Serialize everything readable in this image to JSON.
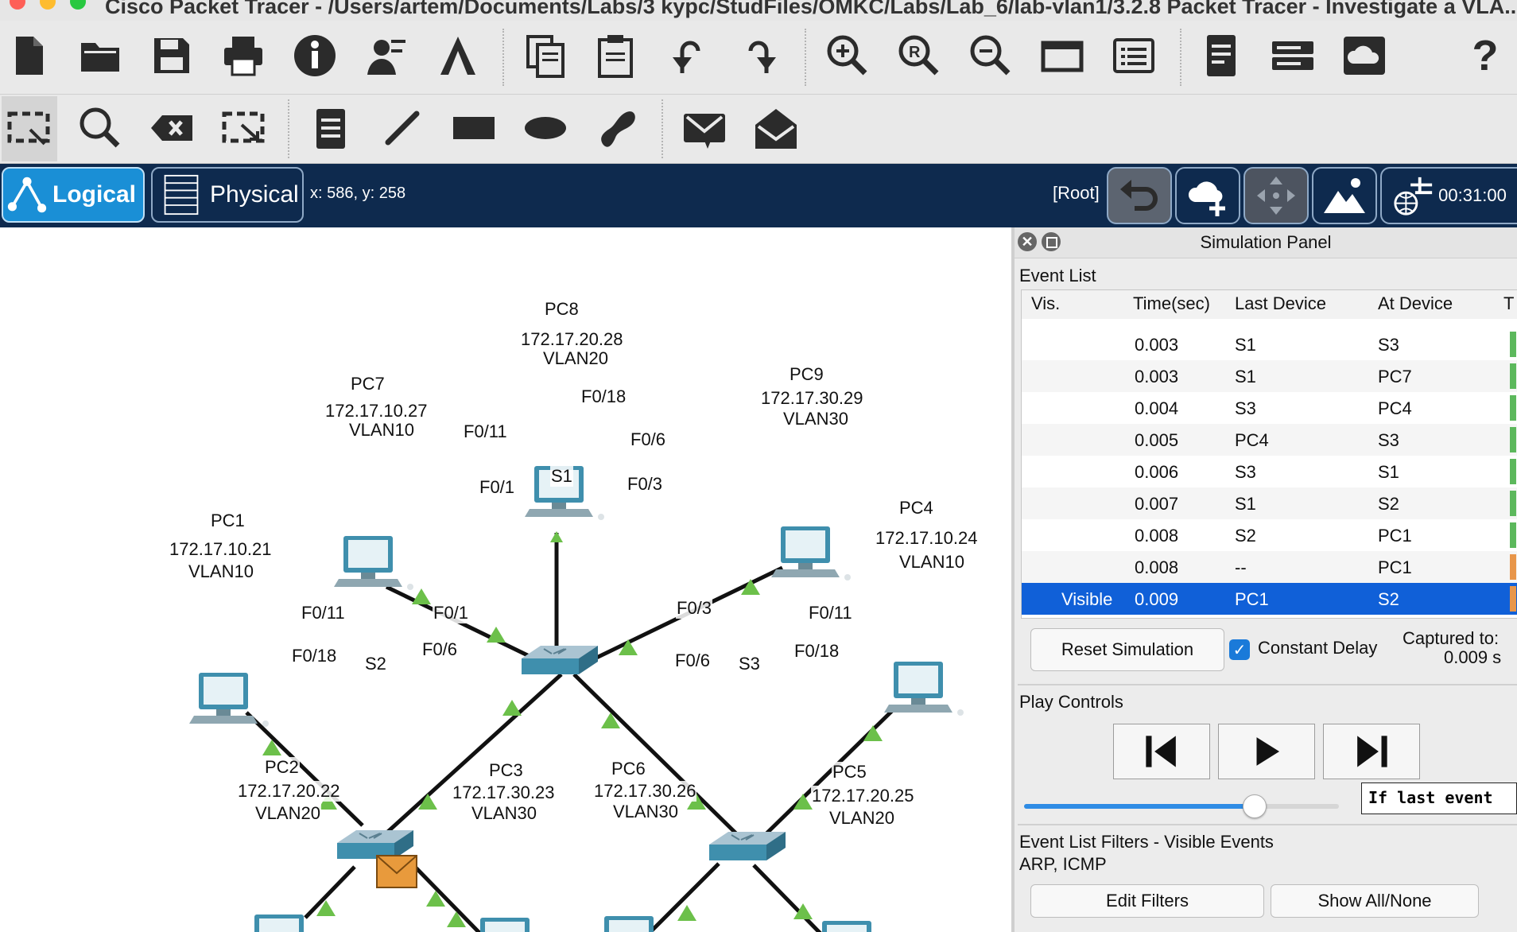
{
  "window": {
    "title": "Cisco Packet Tracer - /Users/artem/Documents/Labs/3 kypc/StudFiles/OMKC/Labs/Lab_6/lab-vlan1/3.2.8 Packet Tracer - Investigate a VLA..."
  },
  "main_toolbar": {
    "icons": [
      "new-file-icon",
      "open-folder-icon",
      "save-icon",
      "print-icon",
      "info-icon",
      "user-profile-icon",
      "activity-wizard-icon",
      "copy-icon",
      "paste-icon",
      "undo-icon",
      "redo-icon",
      "zoom-in-icon",
      "zoom-reset-icon",
      "zoom-out-icon",
      "drawing-palette-icon",
      "custom-device-dialog-icon",
      "pdu-list-icon",
      "network-device-icon",
      "cloud-server-icon",
      "help-icon"
    ],
    "help_label": "?"
  },
  "tool_toolbar": {
    "icons": [
      "select-icon",
      "inspect-icon",
      "delete-icon",
      "resize-icon",
      "note-icon",
      "line-icon",
      "rectangle-icon",
      "ellipse-icon",
      "freeform-icon",
      "simple-pdu-icon",
      "complex-pdu-icon"
    ]
  },
  "nav": {
    "logical_label": "Logical",
    "physical_label": "Physical",
    "coords": "x: 586, y: 258",
    "root_label": "[Root]",
    "time": "00:31:00"
  },
  "network": {
    "devices": [
      {
        "name": "PC8",
        "ip": "172.17.20.28",
        "vlan": "VLAN20"
      },
      {
        "name": "PC7",
        "ip": "172.17.10.27",
        "vlan": "VLAN10"
      },
      {
        "name": "PC9",
        "ip": "172.17.30.29",
        "vlan": "VLAN30"
      },
      {
        "name": "PC1",
        "ip": "172.17.10.21",
        "vlan": "VLAN10"
      },
      {
        "name": "PC4",
        "ip": "172.17.10.24",
        "vlan": "VLAN10"
      },
      {
        "name": "PC2",
        "ip": "172.17.20.22",
        "vlan": "VLAN20"
      },
      {
        "name": "PC3",
        "ip": "172.17.30.23",
        "vlan": "VLAN30"
      },
      {
        "name": "PC6",
        "ip": "172.17.30.26",
        "vlan": "VLAN30"
      },
      {
        "name": "PC5",
        "ip": "172.17.20.25",
        "vlan": "VLAN20"
      }
    ],
    "switches": [
      "S1",
      "S2",
      "S3"
    ],
    "ports": {
      "s1_f018": "F0/18",
      "s1_f011": "F0/11",
      "s1_f06": "F0/6",
      "s1_f01": "F0/1",
      "s1_f03": "F0/3",
      "s2_f011": "F0/11",
      "s2_f01": "F0/1",
      "s2_f018": "F0/18",
      "s2_f06": "F0/6",
      "s3_f03": "F0/3",
      "s3_f011": "F0/11",
      "s3_f06": "F0/6",
      "s3_f018": "F0/18"
    }
  },
  "simulation_panel": {
    "title": "Simulation Panel",
    "event_list_label": "Event List",
    "columns": [
      "Vis.",
      "Time(sec)",
      "Last Device",
      "At Device",
      "T"
    ],
    "events": [
      {
        "vis": "",
        "time": "0.003",
        "last": "S1",
        "at": "S3",
        "color": "#5cb85c"
      },
      {
        "vis": "",
        "time": "0.003",
        "last": "S1",
        "at": "PC7",
        "color": "#5cb85c"
      },
      {
        "vis": "",
        "time": "0.004",
        "last": "S3",
        "at": "PC4",
        "color": "#5cb85c"
      },
      {
        "vis": "",
        "time": "0.005",
        "last": "PC4",
        "at": "S3",
        "color": "#5cb85c"
      },
      {
        "vis": "",
        "time": "0.006",
        "last": "S3",
        "at": "S1",
        "color": "#5cb85c"
      },
      {
        "vis": "",
        "time": "0.007",
        "last": "S1",
        "at": "S2",
        "color": "#5cb85c"
      },
      {
        "vis": "",
        "time": "0.008",
        "last": "S2",
        "at": "PC1",
        "color": "#5cb85c"
      },
      {
        "vis": "",
        "time": "0.008",
        "last": "--",
        "at": "PC1",
        "color": "#e8964a"
      },
      {
        "vis": "Visible",
        "time": "0.009",
        "last": "PC1",
        "at": "S2",
        "color": "#e8964a",
        "selected": true
      }
    ],
    "reset_label": "Reset Simulation",
    "constant_delay_label": "Constant Delay",
    "constant_delay_checked": true,
    "captured_label": "Captured to:",
    "captured_value": "0.009 s",
    "play_controls_label": "Play Controls",
    "tooltip": "If last event",
    "speed_slider_value": 0.73,
    "filters_label": "Event List Filters - Visible Events",
    "filters_value": "ARP, ICMP",
    "edit_filters_label": "Edit Filters",
    "show_all_label": "Show All/None"
  }
}
